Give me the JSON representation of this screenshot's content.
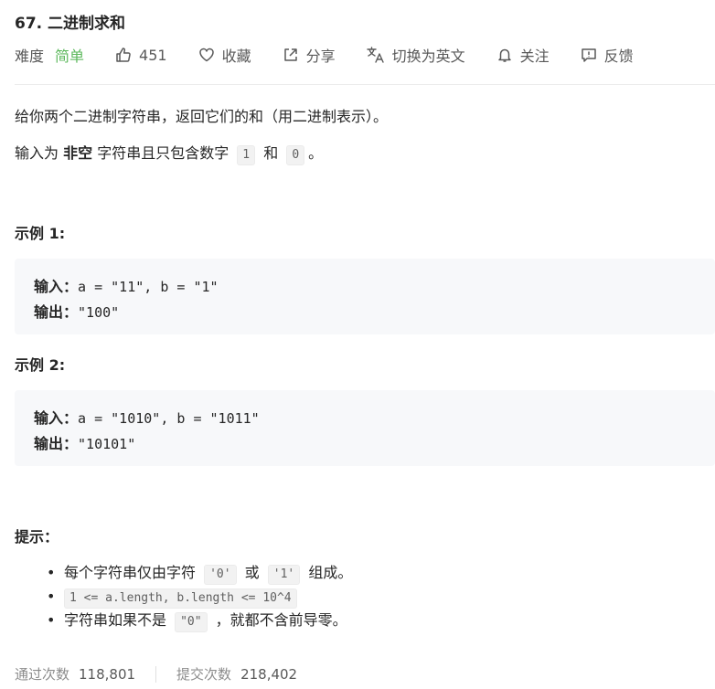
{
  "problem": {
    "title": "67. 二进制求和",
    "difficulty_label": "难度",
    "difficulty_value": "简单"
  },
  "toolbar": {
    "likes": "451",
    "favorite_label": "收藏",
    "share_label": "分享",
    "switch_lang_label": "切换为英文",
    "follow_label": "关注",
    "feedback_label": "反馈"
  },
  "description": {
    "line1": "给你两个二进制字符串，返回它们的和（用二进制表示）。",
    "line2_part1": "输入为 ",
    "line2_bold": "非空",
    "line2_part2": " 字符串且只包含数字 ",
    "line2_code1": "1",
    "line2_and": " 和 ",
    "line2_code2": "0",
    "line2_end": "。"
  },
  "examples": [
    {
      "heading": "示例 1:",
      "input_label": "输入：",
      "input_value": "a = \"11\", b = \"1\"",
      "output_label": "输出：",
      "output_value": "\"100\""
    },
    {
      "heading": "示例 2:",
      "input_label": "输入：",
      "input_value": "a = \"1010\", b = \"1011\"",
      "output_label": "输出：",
      "output_value": "\"10101\""
    }
  ],
  "hints": {
    "heading": "提示：",
    "h1_pre": "每个字符串仅由字符 ",
    "h1_code1": "'0'",
    "h1_mid": " 或 ",
    "h1_code2": "'1'",
    "h1_post": " 组成。",
    "h2_code": "1 <= a.length, b.length <= 10^4",
    "h3_pre": "字符串如果不是 ",
    "h3_code": "\"0\"",
    "h3_post": " ，就都不含前导零。"
  },
  "stats": {
    "accepted_label": "通过次数",
    "accepted_value": "118,801",
    "submissions_label": "提交次数",
    "submissions_value": "218,402"
  },
  "colors": {
    "easy": "#5cb85c",
    "code_bg": "#f7f8fa"
  }
}
